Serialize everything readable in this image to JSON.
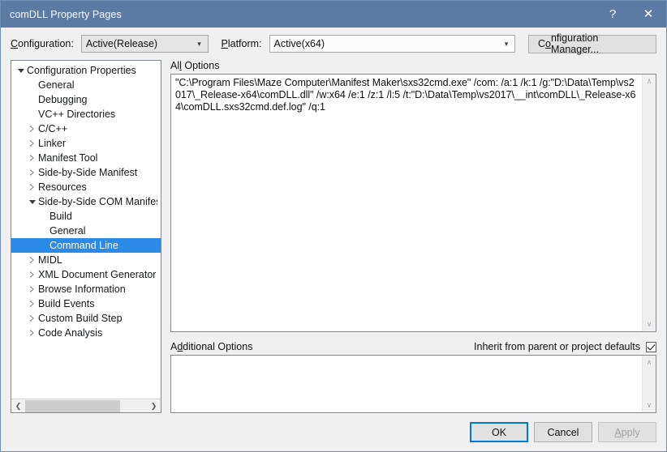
{
  "window": {
    "title": "comDLL Property Pages",
    "help_icon": "?",
    "close_icon": "✕"
  },
  "toolbar": {
    "configuration_label": "Configuration:",
    "configuration_accesskey": "C",
    "configuration_value": "Active(Release)",
    "platform_label": "Platform:",
    "platform_accesskey": "P",
    "platform_value": "Active(x64)",
    "configuration_manager_label": "Configuration Manager...",
    "configuration_manager_accesskey": "o",
    "dropdown_icon": "chevron-down-icon"
  },
  "tree": {
    "nodes": [
      {
        "label": "Configuration Properties",
        "indent": 0,
        "state": "expanded",
        "selected": false
      },
      {
        "label": "General",
        "indent": 1,
        "state": "leaf",
        "selected": false
      },
      {
        "label": "Debugging",
        "indent": 1,
        "state": "leaf",
        "selected": false
      },
      {
        "label": "VC++ Directories",
        "indent": 1,
        "state": "leaf",
        "selected": false
      },
      {
        "label": "C/C++",
        "indent": 1,
        "state": "collapsed",
        "selected": false
      },
      {
        "label": "Linker",
        "indent": 1,
        "state": "collapsed",
        "selected": false
      },
      {
        "label": "Manifest Tool",
        "indent": 1,
        "state": "collapsed",
        "selected": false
      },
      {
        "label": "Side-by-Side Manifest",
        "indent": 1,
        "state": "collapsed",
        "selected": false
      },
      {
        "label": "Resources",
        "indent": 1,
        "state": "collapsed",
        "selected": false
      },
      {
        "label": "Side-by-Side COM Manifest",
        "indent": 1,
        "state": "expanded",
        "selected": false
      },
      {
        "label": "Build",
        "indent": 2,
        "state": "leaf",
        "selected": false
      },
      {
        "label": "General",
        "indent": 2,
        "state": "leaf",
        "selected": false
      },
      {
        "label": "Command Line",
        "indent": 2,
        "state": "leaf",
        "selected": true
      },
      {
        "label": "MIDL",
        "indent": 1,
        "state": "collapsed",
        "selected": false
      },
      {
        "label": "XML Document Generator",
        "indent": 1,
        "state": "collapsed",
        "selected": false
      },
      {
        "label": "Browse Information",
        "indent": 1,
        "state": "collapsed",
        "selected": false
      },
      {
        "label": "Build Events",
        "indent": 1,
        "state": "collapsed",
        "selected": false
      },
      {
        "label": "Custom Build Step",
        "indent": 1,
        "state": "collapsed",
        "selected": false
      },
      {
        "label": "Code Analysis",
        "indent": 1,
        "state": "collapsed",
        "selected": false
      }
    ],
    "hscroll_left_icon": "❮",
    "hscroll_right_icon": "❯"
  },
  "all_options": {
    "label": "All Options",
    "accesskey": "l",
    "value": "\"C:\\Program Files\\Maze Computer\\Manifest Maker\\sxs32cmd.exe\" /com: /a:1 /k:1 /g:\"D:\\Data\\Temp\\vs2017\\_Release-x64\\comDLL.dll\" /w:x64 /e:1 /z:1 /l:5 /t:\"D:\\Data\\Temp\\vs2017\\__int\\comDLL\\_Release-x64\\comDLL.sxs32cmd.def.log\" /q:1",
    "scroll_up_icon": "∧",
    "scroll_down_icon": "∨"
  },
  "additional_options": {
    "label": "Additional Options",
    "accesskey": "d",
    "value": "",
    "inherit_label": "Inherit from parent or project defaults",
    "inherit_checked": true,
    "scroll_up_icon": "∧",
    "scroll_down_icon": "∨"
  },
  "footer": {
    "ok_label": "OK",
    "cancel_label": "Cancel",
    "apply_label": "Apply",
    "apply_accesskey": "A",
    "apply_disabled": true
  },
  "colors": {
    "titlebar": "#5b7ba5",
    "dialog_bg": "#f0f0f0",
    "selection": "#2a8ae6",
    "accent": "#0078d7",
    "border": "#6f8fb5"
  }
}
